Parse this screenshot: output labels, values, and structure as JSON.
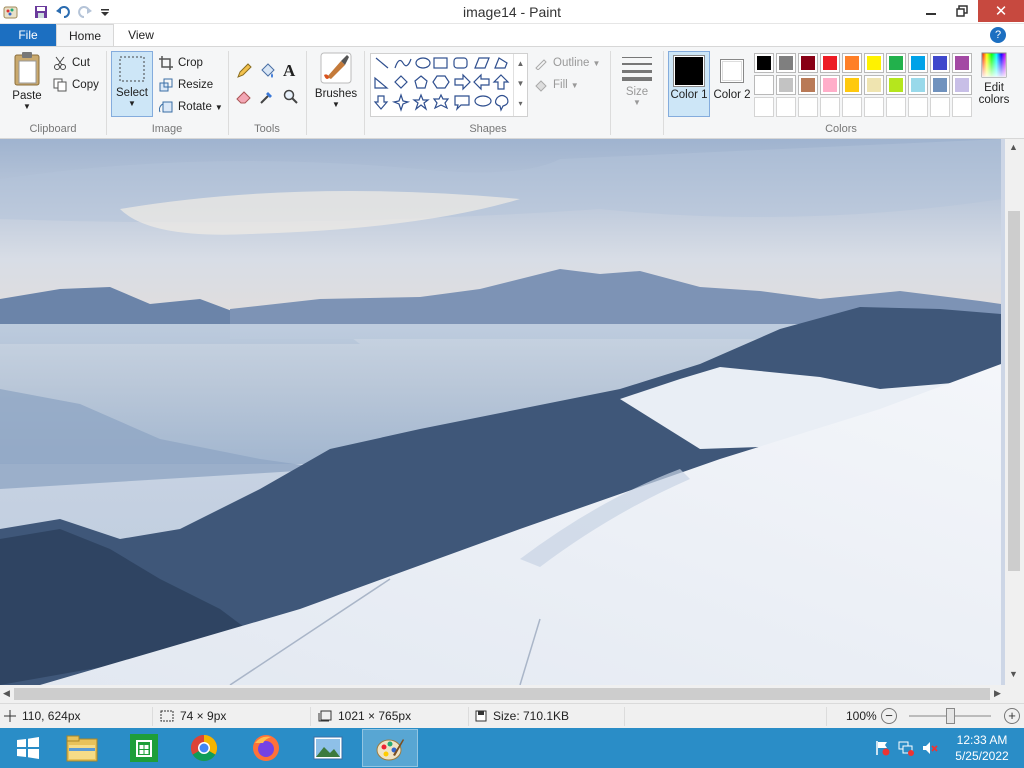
{
  "window": {
    "title": "image14 - Paint",
    "quick_access": [
      "paint-app-icon",
      "save-icon",
      "undo-icon",
      "redo-icon",
      "customize-dropdown-icon"
    ]
  },
  "tabs": {
    "file": "File",
    "home": "Home",
    "view": "View"
  },
  "ribbon": {
    "clipboard": {
      "label": "Clipboard",
      "paste": "Paste",
      "cut": "Cut",
      "copy": "Copy"
    },
    "image": {
      "label": "Image",
      "select": "Select",
      "crop": "Crop",
      "resize": "Resize",
      "rotate": "Rotate"
    },
    "tools": {
      "label": "Tools"
    },
    "brushes": {
      "label": "Brushes"
    },
    "shapes": {
      "label": "Shapes",
      "outline": "Outline",
      "fill": "Fill"
    },
    "size": {
      "label": "Size"
    },
    "colors": {
      "label": "Colors",
      "color1": "Color 1",
      "color2": "Color 2",
      "edit": "Edit colors",
      "color1_value": "#000000",
      "color2_value": "#ffffff",
      "palette_row1": [
        "#000000",
        "#7f7f7f",
        "#880015",
        "#ed1c24",
        "#ff7f27",
        "#fff200",
        "#22b14c",
        "#00a2e8",
        "#3f48cc",
        "#a349a4"
      ],
      "palette_row2": [
        "#ffffff",
        "#c3c3c3",
        "#b97a57",
        "#ffaec9",
        "#ffc90e",
        "#efe4b0",
        "#b5e61d",
        "#99d9ea",
        "#7092be",
        "#c8bfe7"
      ],
      "palette_row3": [
        "#ffffff",
        "#ffffff",
        "#ffffff",
        "#ffffff",
        "#ffffff",
        "#ffffff",
        "#ffffff",
        "#ffffff",
        "#ffffff",
        "#ffffff"
      ]
    }
  },
  "status": {
    "cursor": "110, 624px",
    "selection": "74 × 9px",
    "image_size": "1021 × 765px",
    "file_size": "Size: 710.1KB",
    "zoom": "100%",
    "zoom_level": 0.5
  },
  "taskbar": {
    "apps": [
      "start-button",
      "file-explorer-icon",
      "store-icon",
      "chrome-icon",
      "firefox-icon",
      "photos-icon",
      "paint-icon"
    ],
    "time": "12:33 AM",
    "date": "5/25/2022"
  }
}
